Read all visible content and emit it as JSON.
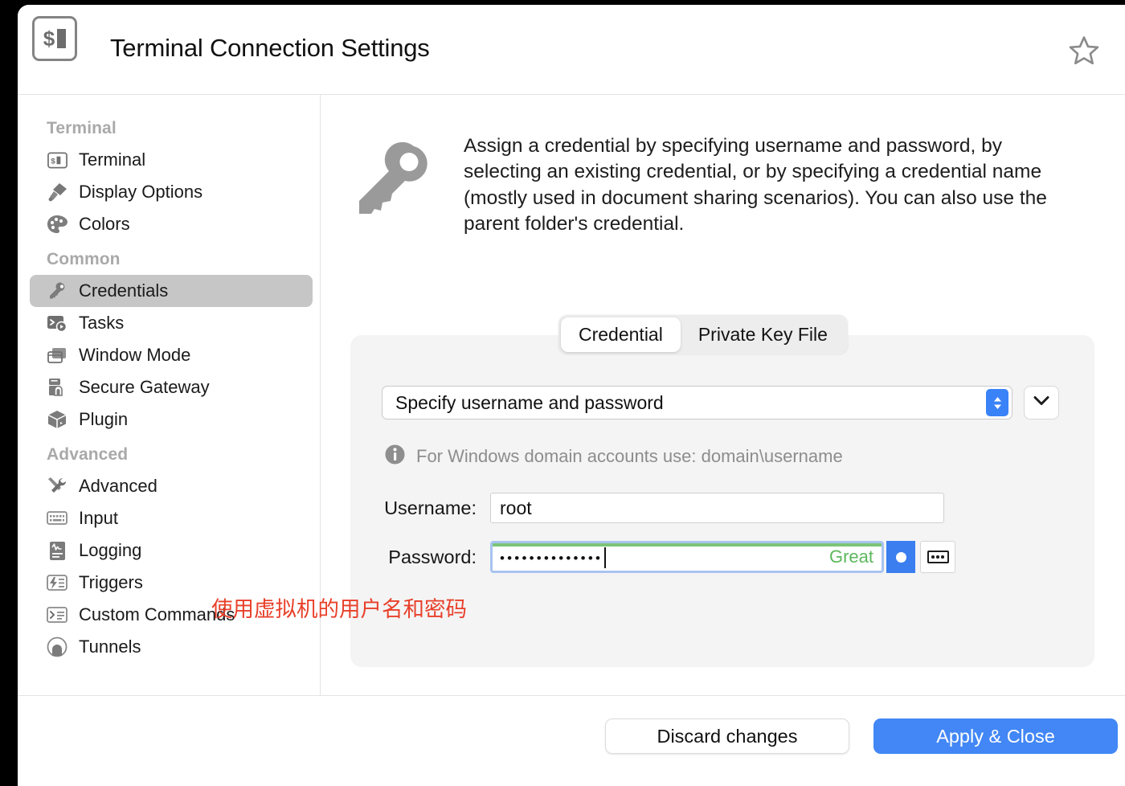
{
  "window": {
    "title": "Terminal Connection Settings",
    "app_icon": "terminal-prompt-icon",
    "favorite_icon": "star-outline-icon"
  },
  "sidebar": {
    "groups": [
      {
        "title": "Terminal",
        "items": [
          {
            "label": "Terminal",
            "icon": "terminal-icon",
            "selected": false
          },
          {
            "label": "Display Options",
            "icon": "paint-brush-icon",
            "selected": false
          },
          {
            "label": "Colors",
            "icon": "palette-icon",
            "selected": false
          }
        ]
      },
      {
        "title": "Common",
        "items": [
          {
            "label": "Credentials",
            "icon": "key-icon",
            "selected": true
          },
          {
            "label": "Tasks",
            "icon": "terminal-play-icon",
            "selected": false
          },
          {
            "label": "Window Mode",
            "icon": "windows-icon",
            "selected": false
          },
          {
            "label": "Secure Gateway",
            "icon": "gateway-icon",
            "selected": false
          },
          {
            "label": "Plugin",
            "icon": "box-icon",
            "selected": false
          }
        ]
      },
      {
        "title": "Advanced",
        "items": [
          {
            "label": "Advanced",
            "icon": "tools-icon",
            "selected": false
          },
          {
            "label": "Input",
            "icon": "keyboard-icon",
            "selected": false
          },
          {
            "label": "Logging",
            "icon": "log-document-icon",
            "selected": false
          },
          {
            "label": "Triggers",
            "icon": "trigger-bolt-icon",
            "selected": false
          },
          {
            "label": "Custom Commands",
            "icon": "command-prompt-icon",
            "selected": false
          },
          {
            "label": "Tunnels",
            "icon": "tunnel-icon",
            "selected": false
          }
        ]
      }
    ]
  },
  "content": {
    "description": "Assign a credential by specifying username and password, by selecting an existing credential, or by specifying a credential name (mostly used in document sharing scenarios). You can also use the parent folder's credential.",
    "description_icon": "key-large-icon",
    "tabs": [
      {
        "label": "Credential",
        "active": true
      },
      {
        "label": "Private Key File",
        "active": false
      }
    ],
    "credential_select": {
      "value": "Specify username and password",
      "stepper_icon": "stepper-up-down-icon",
      "dropdown_icon": "chevron-down-icon"
    },
    "hint": {
      "icon": "info-icon",
      "text": "For Windows domain accounts use: domain\\username"
    },
    "username": {
      "label": "Username:",
      "value": "root"
    },
    "password": {
      "label": "Password:",
      "masked_value": "••••••••••••••",
      "dot_count": 14,
      "strength_label": "Great",
      "strength_color": "#5cb85c",
      "reveal_icon": "dot-toggle-icon",
      "keypad_icon": "keypad-icon"
    }
  },
  "annotation": {
    "text": "使用虚拟机的用户名和密码",
    "color": "#e8402a"
  },
  "footer": {
    "discard_label": "Discard changes",
    "apply_label": "Apply & Close",
    "apply_color": "#4287f5"
  }
}
